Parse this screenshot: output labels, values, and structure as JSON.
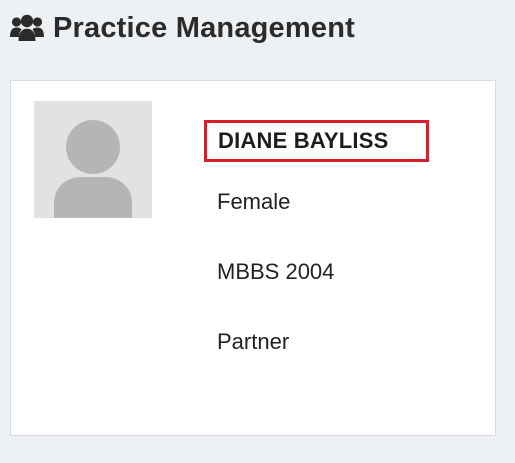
{
  "header": {
    "icon": "users-icon",
    "title": "Practice Management"
  },
  "profile": {
    "avatar_icon": "user-placeholder-icon",
    "name": "DIANE BAYLISS",
    "gender": "Female",
    "qualification": "MBBS 2004",
    "role": "Partner"
  },
  "colors": {
    "highlight_border": "#d4202a",
    "page_background": "#eef1f4"
  }
}
